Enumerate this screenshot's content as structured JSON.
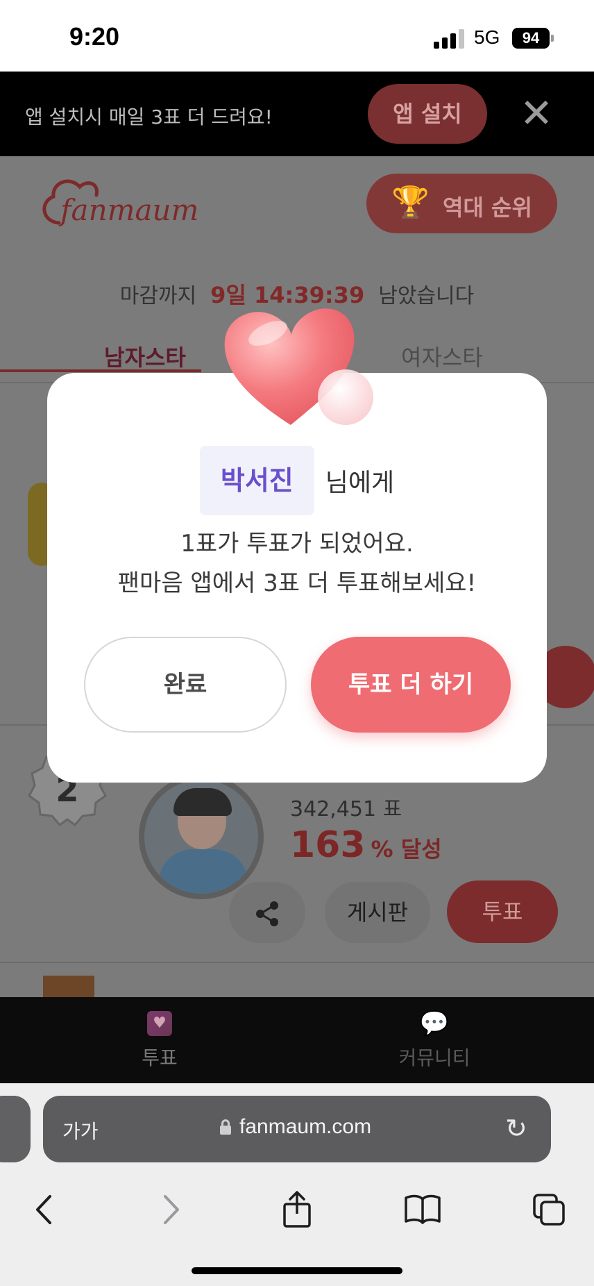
{
  "status_bar": {
    "time": "9:20",
    "network": "5G",
    "battery": "94"
  },
  "banner": {
    "message": "앱 설치시 매일 3표 더 드려요!",
    "install_label": "앱 설치",
    "close_glyph": "✕"
  },
  "header": {
    "logo_text": "fanmaum",
    "rank_button_label": "역대 순위"
  },
  "deadline": {
    "prefix": "마감까지",
    "time": "9일 14:39:39",
    "suffix": "남았습니다"
  },
  "tabs": {
    "men": "남자스타",
    "women": "여자스타"
  },
  "ranking_card": {
    "rank": "2",
    "votes": "342,451 표",
    "percent_value": "163",
    "percent_unit": "% 달성",
    "board_label": "게시판",
    "vote_label": "투표"
  },
  "bottom_nav": {
    "vote_label": "투표",
    "community_label": "커뮤니티"
  },
  "modal": {
    "recipient_name": "박서진",
    "recipient_suffix": "님에게",
    "line1": "1표가 투표가 되었어요.",
    "line2": "팬마음 앱에서 3표 더 투표해보세요!",
    "done_label": "완료",
    "more_label": "투표 더 하기"
  },
  "safari": {
    "text_size_label": "가가",
    "url": "fanmaum.com"
  },
  "colors": {
    "accent": "#ef6c72",
    "recipient": "#6a4fcc",
    "deadline_time": "#e0394a"
  }
}
